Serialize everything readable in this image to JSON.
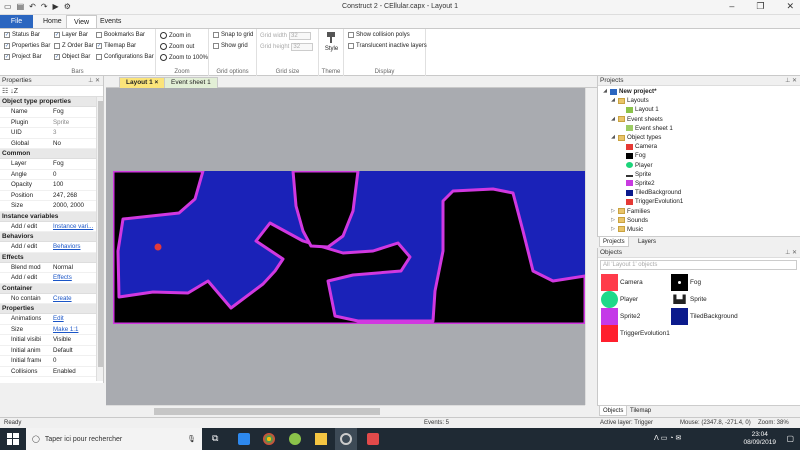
{
  "titlebar": {
    "title": "Construct 2 - CEllular.capx - Layout 1"
  },
  "ribbon_tabs": [
    "File",
    "Home",
    "View",
    "Events"
  ],
  "ribbon": {
    "bars_group": {
      "label": "Bars",
      "items": [
        "Status Bar",
        "Properties Bar",
        "Project Bar",
        "Layer Bar",
        "Z Order Bar",
        "Object Bar",
        "Bookmarks Bar",
        "Tilemap Bar",
        "Configurations Bar"
      ]
    },
    "zoom_group": {
      "label": "Zoom",
      "zoom_in": "Zoom in",
      "zoom_out": "Zoom out",
      "zoom_100": "Zoom to 100%"
    },
    "grid_options": {
      "label": "Grid options",
      "snap": "Snap to grid",
      "show": "Show grid"
    },
    "grid_size": {
      "label": "Grid size",
      "width_label": "Grid width",
      "width_value": "32",
      "height_label": "Grid height",
      "height_value": "32"
    },
    "theme": {
      "label": "Theme",
      "style": "Style"
    },
    "display": {
      "label": "Display",
      "collision": "Show collision polys",
      "translucent": "Translucent inactive layers"
    }
  },
  "properties": {
    "title": "Properties",
    "sections": [
      {
        "name": "Object type properties",
        "rows": [
          {
            "k": "Name",
            "v": "Fog"
          },
          {
            "k": "Plugin",
            "v": "Sprite",
            "dim": true
          },
          {
            "k": "UID",
            "v": "3",
            "dim": true
          },
          {
            "k": "Global",
            "v": "No"
          }
        ]
      },
      {
        "name": "Common",
        "rows": [
          {
            "k": "Layer",
            "v": "Fog"
          },
          {
            "k": "Angle",
            "v": "0"
          },
          {
            "k": "Opacity",
            "v": "100"
          },
          {
            "k": "Position",
            "v": "247, 268"
          },
          {
            "k": "Size",
            "v": "2000, 2000"
          }
        ]
      },
      {
        "name": "Instance variables",
        "rows": [
          {
            "k": "Add / edit",
            "v": "Instance vari...",
            "link": true
          }
        ]
      },
      {
        "name": "Behaviors",
        "rows": [
          {
            "k": "Add / edit",
            "v": "Behaviors",
            "link": true
          }
        ]
      },
      {
        "name": "Effects",
        "rows": [
          {
            "k": "Blend mode",
            "v": "Normal"
          },
          {
            "k": "Add / edit",
            "v": "Effects",
            "link": true
          }
        ]
      },
      {
        "name": "Container",
        "rows": [
          {
            "k": "No container",
            "v": "Create",
            "link": true
          }
        ]
      },
      {
        "name": "Properties",
        "rows": [
          {
            "k": "Animations",
            "v": "Edit",
            "link": true
          },
          {
            "k": "Size",
            "v": "Make 1:1",
            "link": true
          },
          {
            "k": "Initial visibil...",
            "v": "Visible"
          },
          {
            "k": "Initial anim...",
            "v": "Default"
          },
          {
            "k": "Initial frame",
            "v": "0"
          },
          {
            "k": "Collisions",
            "v": "Enabled"
          }
        ]
      }
    ]
  },
  "doc_tabs": {
    "layout": "Layout 1",
    "close": "×",
    "event_sheet": "Event sheet 1"
  },
  "projects": {
    "title": "Projects",
    "tree": [
      {
        "label": "New project*",
        "level": 0,
        "bold": true,
        "icon": "project"
      },
      {
        "label": "Layouts",
        "level": 1,
        "icon": "folder"
      },
      {
        "label": "Layout 1",
        "level": 2,
        "icon": "layout"
      },
      {
        "label": "Event sheets",
        "level": 1,
        "icon": "folder"
      },
      {
        "label": "Event sheet 1",
        "level": 2,
        "icon": "eventsheet"
      },
      {
        "label": "Object types",
        "level": 1,
        "icon": "folder"
      },
      {
        "label": "Camera",
        "level": 2,
        "icon": "red"
      },
      {
        "label": "Fog",
        "level": 2,
        "icon": "black"
      },
      {
        "label": "Player",
        "level": 2,
        "icon": "green"
      },
      {
        "label": "Sprite",
        "level": 2,
        "icon": "sprite"
      },
      {
        "label": "Sprite2",
        "level": 2,
        "icon": "magenta"
      },
      {
        "label": "TiledBackground",
        "level": 2,
        "icon": "navy"
      },
      {
        "label": "TriggerEvolution1",
        "level": 2,
        "icon": "red"
      },
      {
        "label": "Families",
        "level": 1,
        "icon": "folder"
      },
      {
        "label": "Sounds",
        "level": 1,
        "icon": "folder"
      },
      {
        "label": "Music",
        "level": 1,
        "icon": "folder"
      }
    ],
    "tabs": [
      "Projects",
      "Layers"
    ]
  },
  "objects": {
    "title": "Objects",
    "search_placeholder": "All 'Layout 1' objects",
    "items": [
      "Camera",
      "Fog",
      "Player",
      "Sprite",
      "Sprite2",
      "TiledBackground",
      "TriggerEvolution1"
    ],
    "tabs": [
      "Objects",
      "Tilemap"
    ]
  },
  "status": {
    "ready": "Ready",
    "events": "Events: 5",
    "active_layer": "Active layer: Trigger",
    "mouse": "Mouse: (2347.8, -271.4, 0)",
    "zoom": "Zoom: 38%"
  },
  "taskbar": {
    "search": "Taper ici pour rechercher",
    "time": "23:04",
    "date": "08/09/2019"
  },
  "colors": {
    "accent": "#2b66c0",
    "layout_tab": "#fbe47a",
    "blue_region": "#1a22b8",
    "outline": "#d138e0"
  }
}
